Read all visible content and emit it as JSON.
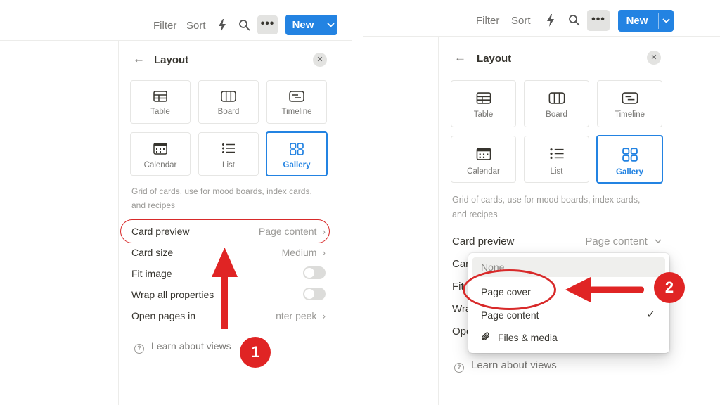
{
  "toolbar": {
    "filter": "Filter",
    "sort": "Sort",
    "more_icon": "ellipsis-icon",
    "new_label": "New",
    "icons": [
      "lightning-icon",
      "search-icon",
      "chevron-down-icon"
    ]
  },
  "layout_panel": {
    "title": "Layout",
    "layouts": [
      {
        "label": "Table",
        "icon": "table-icon"
      },
      {
        "label": "Board",
        "icon": "board-icon"
      },
      {
        "label": "Timeline",
        "icon": "timeline-icon"
      },
      {
        "label": "Calendar",
        "icon": "calendar-icon"
      },
      {
        "label": "List",
        "icon": "list-icon"
      },
      {
        "label": "Gallery",
        "icon": "gallery-icon",
        "selected": true
      }
    ],
    "description_line1": "Grid of cards, use for mood boards, index cards,",
    "description_line2": "and recipes",
    "settings": [
      {
        "label": "Card preview",
        "value": "Page content"
      },
      {
        "label": "Card size",
        "value": "Medium"
      },
      {
        "label": "Fit image",
        "toggle": false
      },
      {
        "label": "Wrap all properties",
        "toggle": false
      },
      {
        "label": "Open pages in",
        "value": "Center peek"
      }
    ],
    "help": "Learn about views",
    "right_truncated": {
      "card_size": "Car",
      "fit_image": "Fit",
      "wrap": "Wra",
      "open": "Ope"
    },
    "left_open_value_visible": "nter peek"
  },
  "dropdown": {
    "items": [
      {
        "label": "None"
      },
      {
        "label": "Page cover"
      },
      {
        "label": "Page content",
        "checked": true
      },
      {
        "label": "Files & media",
        "icon": "paperclip-icon"
      }
    ],
    "check_glyph": "✓"
  },
  "annotations": {
    "step1": "1",
    "step2": "2",
    "color": "#d82a2a"
  },
  "colors": {
    "accent": "#2383e2",
    "annotation_red": "#e02424"
  }
}
